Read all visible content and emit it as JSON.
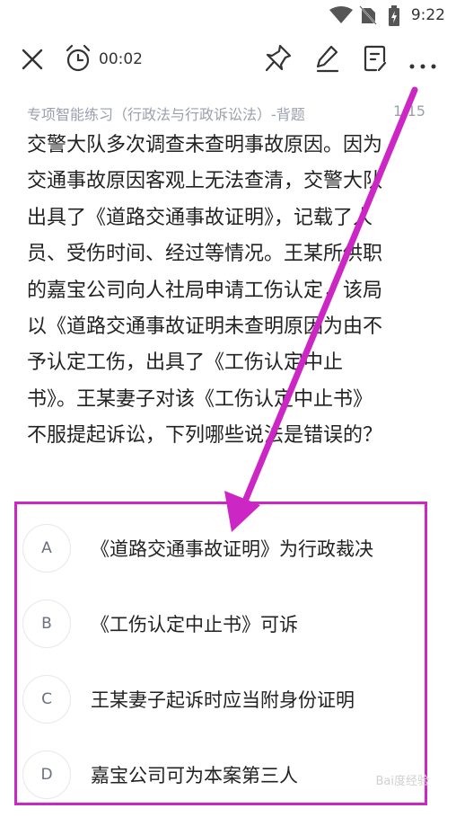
{
  "status_bar": {
    "time": "9:22",
    "icons": [
      "wifi-icon",
      "no-sim-icon",
      "battery-charging-icon"
    ]
  },
  "toolbar": {
    "close_icon": "close-icon",
    "alarm_icon": "alarm-icon",
    "timer": "00:02",
    "pin_icon": "pin-icon",
    "edit_icon": "edit-icon",
    "note_icon": "note-icon",
    "more_icon": "more-icon"
  },
  "subheader": {
    "title": "专项智能练习（行政法与行政诉讼法）-背题",
    "page_current": "1",
    "page_total": "15"
  },
  "question": {
    "lines": [
      "交警大队多次调查未查明事故原因。因为",
      "交通事故原因客观上无法查清，交警大队",
      "出具了《道路交通事故证明》，记载了人",
      "员、受伤时间、经过等情况。王某所供职",
      "的嘉宝公司向人社局申请工伤认定，该局",
      "以《道路交通事故证明未查明原因为由不",
      "予认定工伤，出具了《工伤认定中止",
      "书》。王某妻子对该《工伤认定中止书》",
      "不服提起诉讼，下列哪些说法是错误的？"
    ]
  },
  "options": [
    {
      "letter": "A",
      "text": "《道路交通事故证明》为行政裁决"
    },
    {
      "letter": "B",
      "text": "《工伤认定中止书》可诉"
    },
    {
      "letter": "C",
      "text": "王某妻子起诉时应当附身份证明"
    },
    {
      "letter": "D",
      "text": "嘉宝公司可为本案第三人"
    }
  ],
  "annotation": {
    "color": "#cc27c4"
  },
  "watermark": "Bai度经验"
}
